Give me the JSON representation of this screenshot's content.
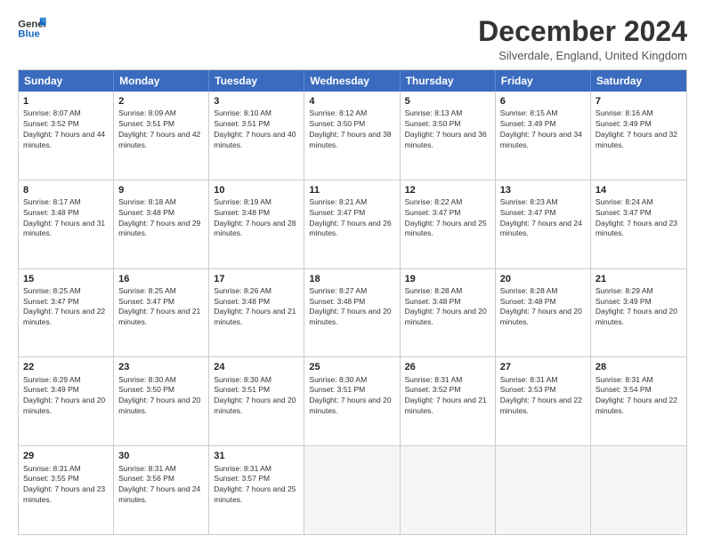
{
  "logo": {
    "line1": "General",
    "line2": "Blue"
  },
  "title": "December 2024",
  "subtitle": "Silverdale, England, United Kingdom",
  "header_days": [
    "Sunday",
    "Monday",
    "Tuesday",
    "Wednesday",
    "Thursday",
    "Friday",
    "Saturday"
  ],
  "weeks": [
    [
      {
        "num": "1",
        "sunrise": "8:07 AM",
        "sunset": "3:52 PM",
        "daylight": "7 hours and 44 minutes."
      },
      {
        "num": "2",
        "sunrise": "8:09 AM",
        "sunset": "3:51 PM",
        "daylight": "7 hours and 42 minutes."
      },
      {
        "num": "3",
        "sunrise": "8:10 AM",
        "sunset": "3:51 PM",
        "daylight": "7 hours and 40 minutes."
      },
      {
        "num": "4",
        "sunrise": "8:12 AM",
        "sunset": "3:50 PM",
        "daylight": "7 hours and 38 minutes."
      },
      {
        "num": "5",
        "sunrise": "8:13 AM",
        "sunset": "3:50 PM",
        "daylight": "7 hours and 36 minutes."
      },
      {
        "num": "6",
        "sunrise": "8:15 AM",
        "sunset": "3:49 PM",
        "daylight": "7 hours and 34 minutes."
      },
      {
        "num": "7",
        "sunrise": "8:16 AM",
        "sunset": "3:49 PM",
        "daylight": "7 hours and 32 minutes."
      }
    ],
    [
      {
        "num": "8",
        "sunrise": "8:17 AM",
        "sunset": "3:48 PM",
        "daylight": "7 hours and 31 minutes."
      },
      {
        "num": "9",
        "sunrise": "8:18 AM",
        "sunset": "3:48 PM",
        "daylight": "7 hours and 29 minutes."
      },
      {
        "num": "10",
        "sunrise": "8:19 AM",
        "sunset": "3:48 PM",
        "daylight": "7 hours and 28 minutes."
      },
      {
        "num": "11",
        "sunrise": "8:21 AM",
        "sunset": "3:47 PM",
        "daylight": "7 hours and 26 minutes."
      },
      {
        "num": "12",
        "sunrise": "8:22 AM",
        "sunset": "3:47 PM",
        "daylight": "7 hours and 25 minutes."
      },
      {
        "num": "13",
        "sunrise": "8:23 AM",
        "sunset": "3:47 PM",
        "daylight": "7 hours and 24 minutes."
      },
      {
        "num": "14",
        "sunrise": "8:24 AM",
        "sunset": "3:47 PM",
        "daylight": "7 hours and 23 minutes."
      }
    ],
    [
      {
        "num": "15",
        "sunrise": "8:25 AM",
        "sunset": "3:47 PM",
        "daylight": "7 hours and 22 minutes."
      },
      {
        "num": "16",
        "sunrise": "8:25 AM",
        "sunset": "3:47 PM",
        "daylight": "7 hours and 21 minutes."
      },
      {
        "num": "17",
        "sunrise": "8:26 AM",
        "sunset": "3:48 PM",
        "daylight": "7 hours and 21 minutes."
      },
      {
        "num": "18",
        "sunrise": "8:27 AM",
        "sunset": "3:48 PM",
        "daylight": "7 hours and 20 minutes."
      },
      {
        "num": "19",
        "sunrise": "8:28 AM",
        "sunset": "3:48 PM",
        "daylight": "7 hours and 20 minutes."
      },
      {
        "num": "20",
        "sunrise": "8:28 AM",
        "sunset": "3:48 PM",
        "daylight": "7 hours and 20 minutes."
      },
      {
        "num": "21",
        "sunrise": "8:29 AM",
        "sunset": "3:49 PM",
        "daylight": "7 hours and 20 minutes."
      }
    ],
    [
      {
        "num": "22",
        "sunrise": "8:29 AM",
        "sunset": "3:49 PM",
        "daylight": "7 hours and 20 minutes."
      },
      {
        "num": "23",
        "sunrise": "8:30 AM",
        "sunset": "3:50 PM",
        "daylight": "7 hours and 20 minutes."
      },
      {
        "num": "24",
        "sunrise": "8:30 AM",
        "sunset": "3:51 PM",
        "daylight": "7 hours and 20 minutes."
      },
      {
        "num": "25",
        "sunrise": "8:30 AM",
        "sunset": "3:51 PM",
        "daylight": "7 hours and 20 minutes."
      },
      {
        "num": "26",
        "sunrise": "8:31 AM",
        "sunset": "3:52 PM",
        "daylight": "7 hours and 21 minutes."
      },
      {
        "num": "27",
        "sunrise": "8:31 AM",
        "sunset": "3:53 PM",
        "daylight": "7 hours and 22 minutes."
      },
      {
        "num": "28",
        "sunrise": "8:31 AM",
        "sunset": "3:54 PM",
        "daylight": "7 hours and 22 minutes."
      }
    ],
    [
      {
        "num": "29",
        "sunrise": "8:31 AM",
        "sunset": "3:55 PM",
        "daylight": "7 hours and 23 minutes."
      },
      {
        "num": "30",
        "sunrise": "8:31 AM",
        "sunset": "3:56 PM",
        "daylight": "7 hours and 24 minutes."
      },
      {
        "num": "31",
        "sunrise": "8:31 AM",
        "sunset": "3:57 PM",
        "daylight": "7 hours and 25 minutes."
      },
      null,
      null,
      null,
      null
    ]
  ]
}
